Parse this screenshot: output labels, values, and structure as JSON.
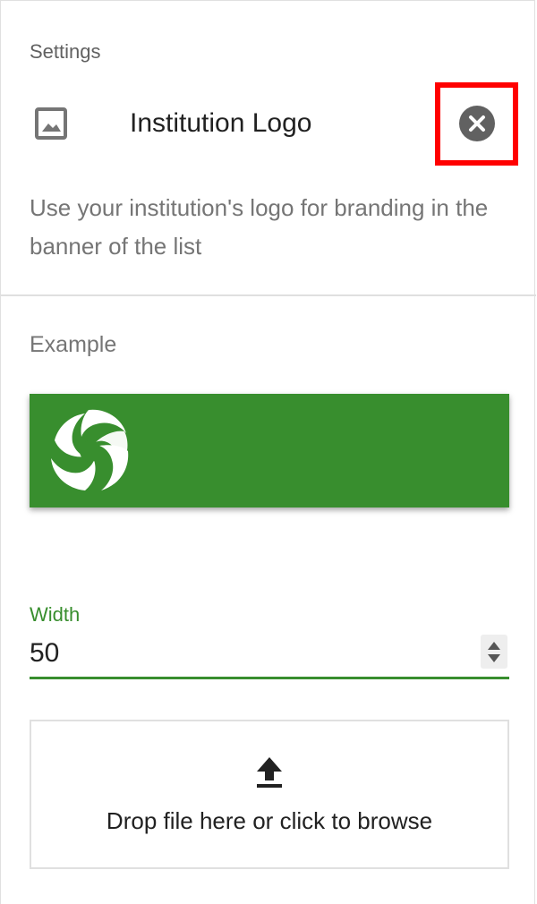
{
  "settings": {
    "section_title": "Settings",
    "item_title": "Institution Logo",
    "description": "Use your institution's logo for branding in the banner of the list",
    "icons": {
      "leading": "image-icon",
      "action": "close-icon"
    }
  },
  "example": {
    "label": "Example",
    "banner_color": "#388e2e",
    "logo_icon": "swirl-logo"
  },
  "width_field": {
    "label": "Width",
    "value": "50",
    "accent_color": "#388e2e"
  },
  "dropzone": {
    "text": "Drop file here or click to browse",
    "icon": "upload-icon"
  },
  "highlight_color": "#ff0000"
}
